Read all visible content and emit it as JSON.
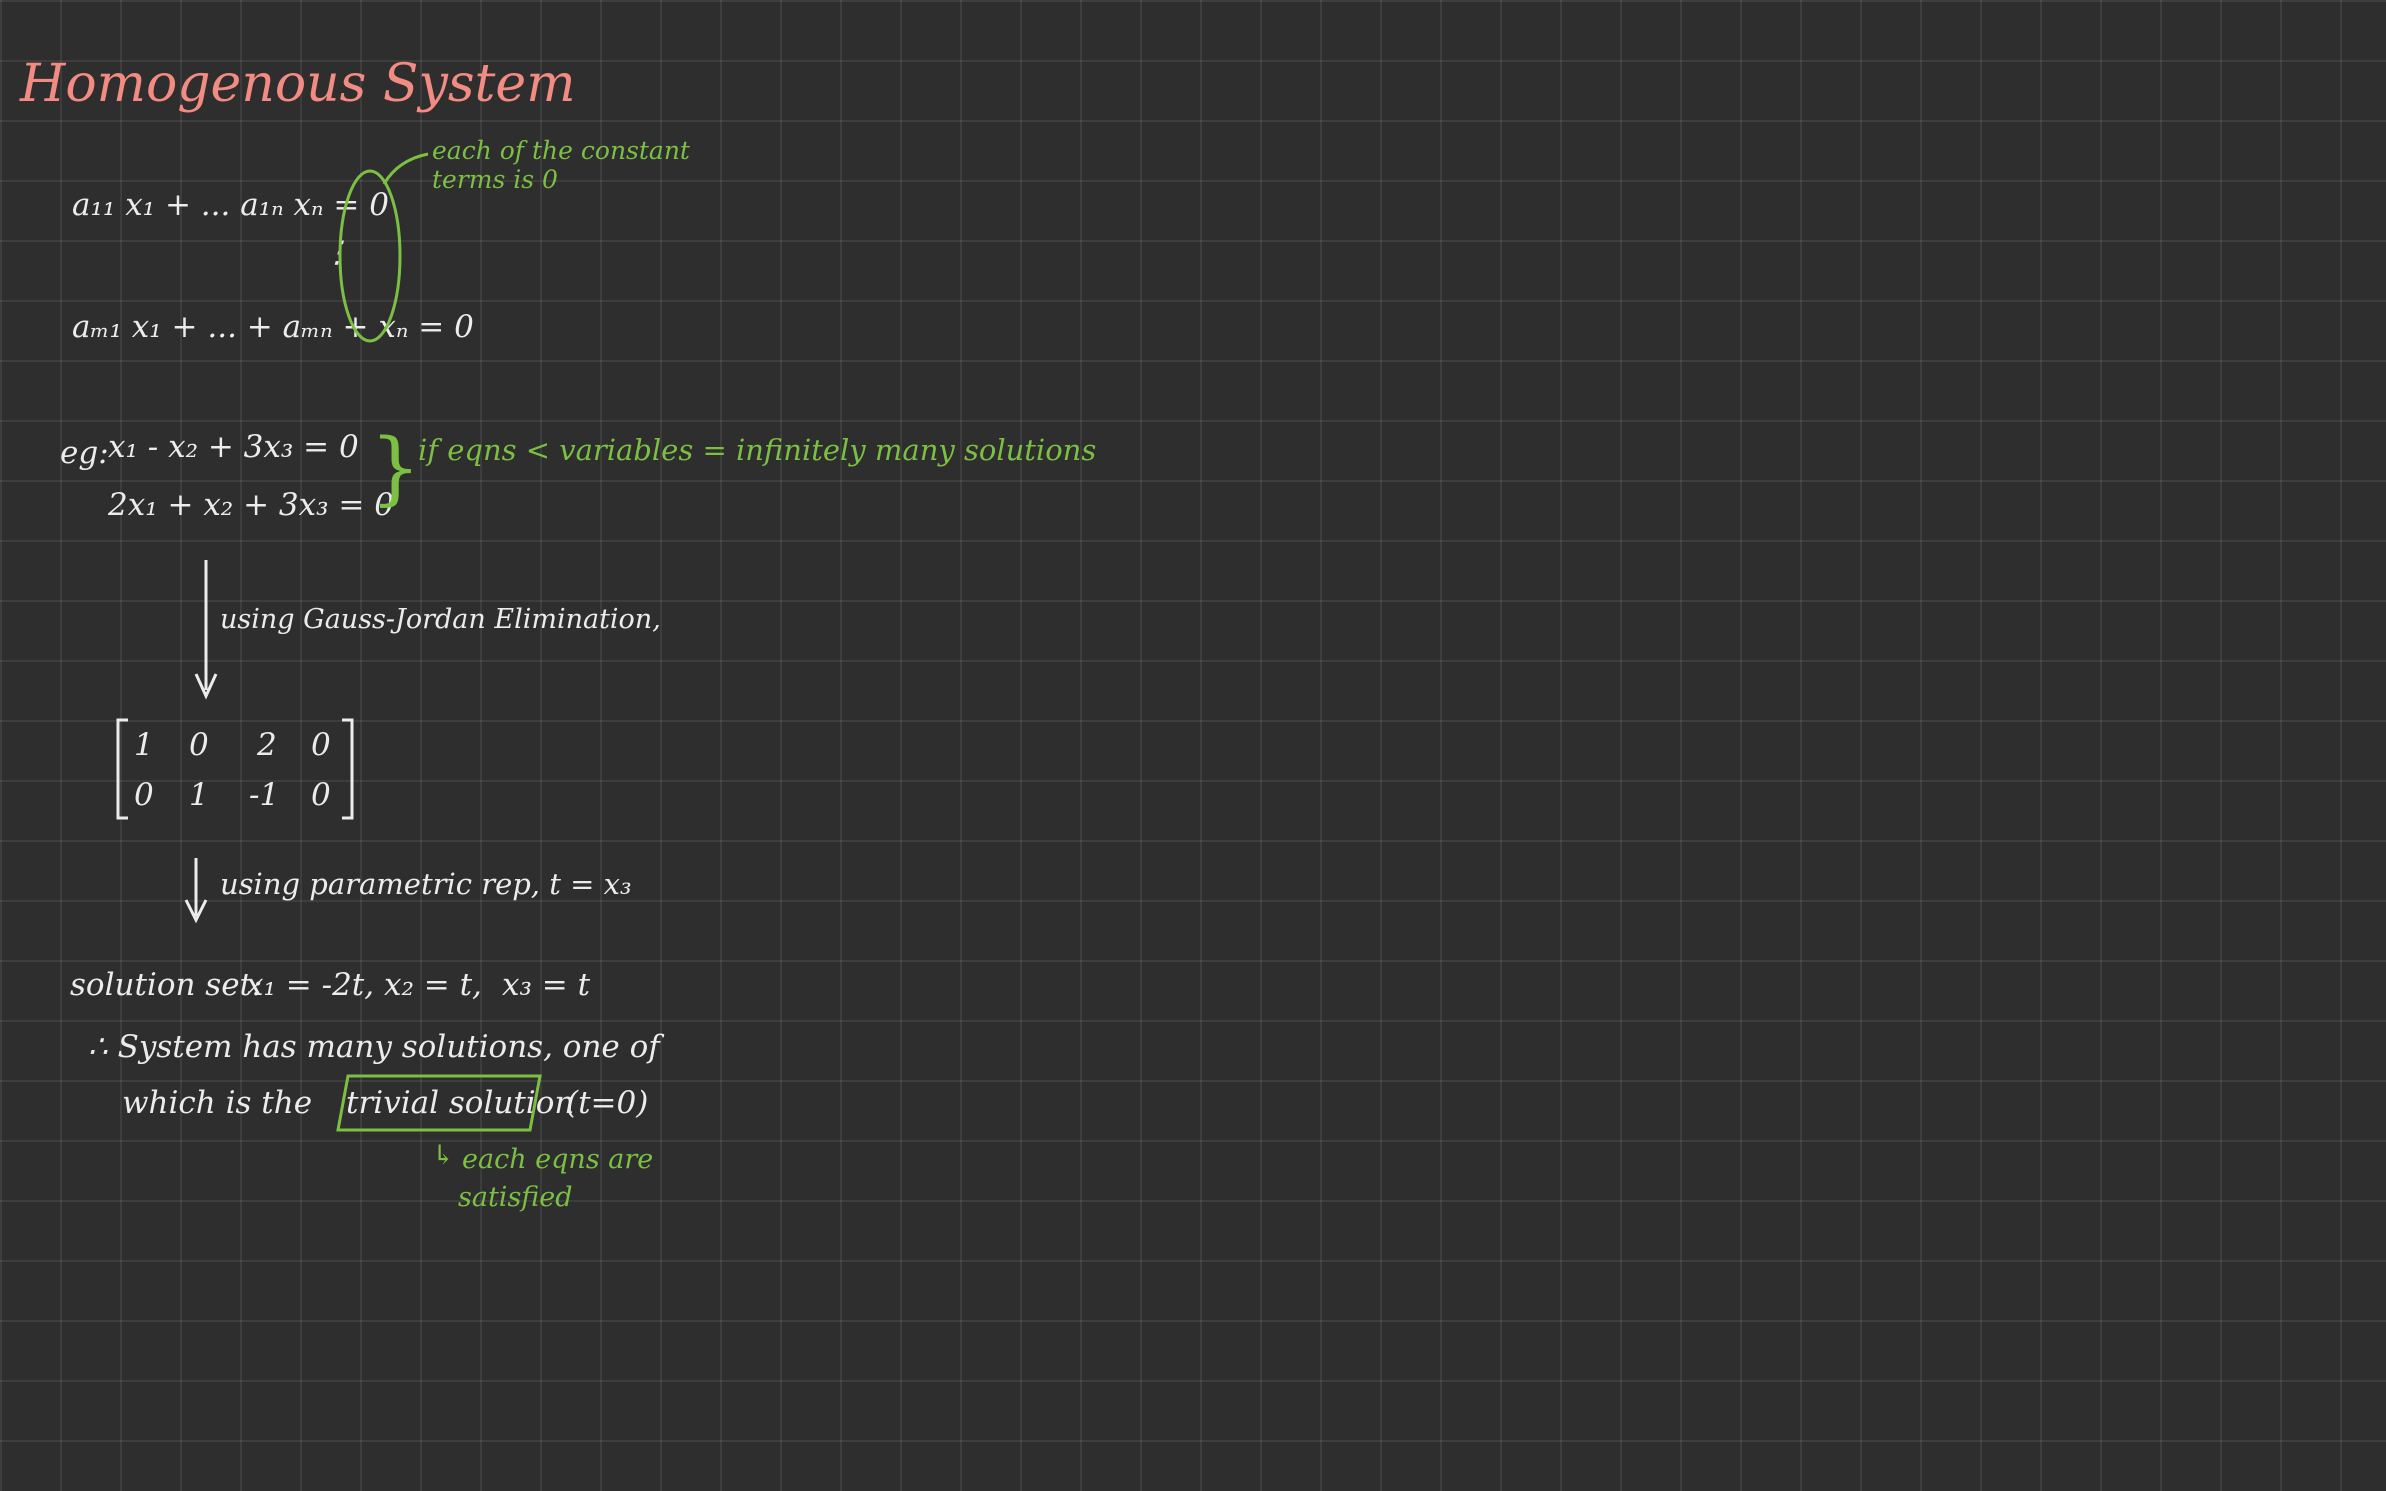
{
  "title": "Homogenous System",
  "colors": {
    "background": "#2e2e2e",
    "ink": "#ececec",
    "accent": "#7bc043",
    "title": "#f28b82"
  },
  "general_form": {
    "row1": "a₁₁ x₁ + ... a₁ₙ xₙ = 0",
    "dots": "⋮",
    "rowm": "aₘ₁ x₁ + ... + aₘₙ + xₙ = 0",
    "note_line1": "each of the constant",
    "note_line2": "terms is 0"
  },
  "example": {
    "label": "eg:",
    "eq1": "x₁ - x₂ + 3x₃ = 0",
    "eq2": "2x₁ + x₂ + 3x₃ = 0",
    "brace": "}",
    "note": "if eqns < variables = infinitely many solutions"
  },
  "step1": "using Gauss-Jordan Elimination,",
  "matrix": {
    "rows": [
      [
        "1",
        "0",
        "2",
        "0"
      ],
      [
        "0",
        "1",
        "-1",
        "0"
      ]
    ]
  },
  "step2": "using parametric rep, t = x₃",
  "solution": {
    "label": "solution set:",
    "x1": "x₁ = -2t,",
    "x2": "x₂ = t,",
    "x3": "x₃ = t"
  },
  "conclusion": {
    "line1": "∴ System has many solutions, one of",
    "line2_pre": "which is the",
    "trivial": "trivial solution",
    "line2_post": "(t=0)"
  },
  "sub_note": {
    "arrow": "↳",
    "line1": "each eqns are",
    "line2": "satisfied"
  }
}
